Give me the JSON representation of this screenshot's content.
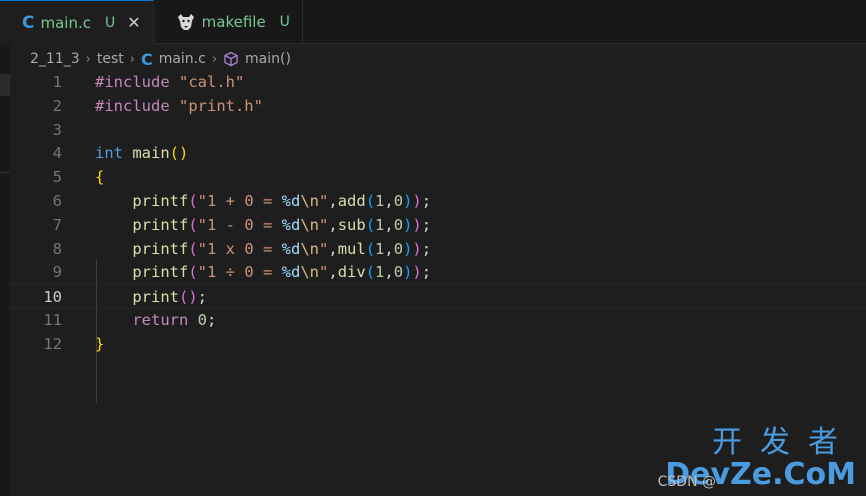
{
  "tabs": [
    {
      "icon": "C",
      "name": "main.c",
      "badge": "U",
      "close": "✕",
      "active": true
    },
    {
      "icon": "gnu-icon",
      "name": "makefile",
      "badge": "U",
      "active": false
    }
  ],
  "breadcrumb": {
    "items": [
      "2_11_3",
      "test",
      "main.c",
      "main()"
    ],
    "c_icon": "C",
    "sep": "›"
  },
  "editor": {
    "current_line": 10,
    "lines": [
      {
        "n": "1",
        "text": "#include \"cal.h\""
      },
      {
        "n": "2",
        "text": "#include \"print.h\""
      },
      {
        "n": "3",
        "text": ""
      },
      {
        "n": "4",
        "text": "int main()"
      },
      {
        "n": "5",
        "text": "{"
      },
      {
        "n": "6",
        "text": "    printf(\"1 + 0 = %d\\n\",add(1,0));"
      },
      {
        "n": "7",
        "text": "    printf(\"1 - 0 = %d\\n\",sub(1,0));"
      },
      {
        "n": "8",
        "text": "    printf(\"1 x 0 = %d\\n\",mul(1,0));"
      },
      {
        "n": "9",
        "text": "    printf(\"1 ÷ 0 = %d\\n\",div(1,0));"
      },
      {
        "n": "10",
        "text": "    print();"
      },
      {
        "n": "11",
        "text": "    return 0;"
      },
      {
        "n": "12",
        "text": "}"
      }
    ]
  },
  "watermark": {
    "cn": "开发者",
    "en": "DevZe.CoM",
    "csdn": "CSDN @"
  },
  "colors": {
    "accent": "#0078d4",
    "untracked": "#73c991",
    "c_icon": "#3a96dd"
  }
}
